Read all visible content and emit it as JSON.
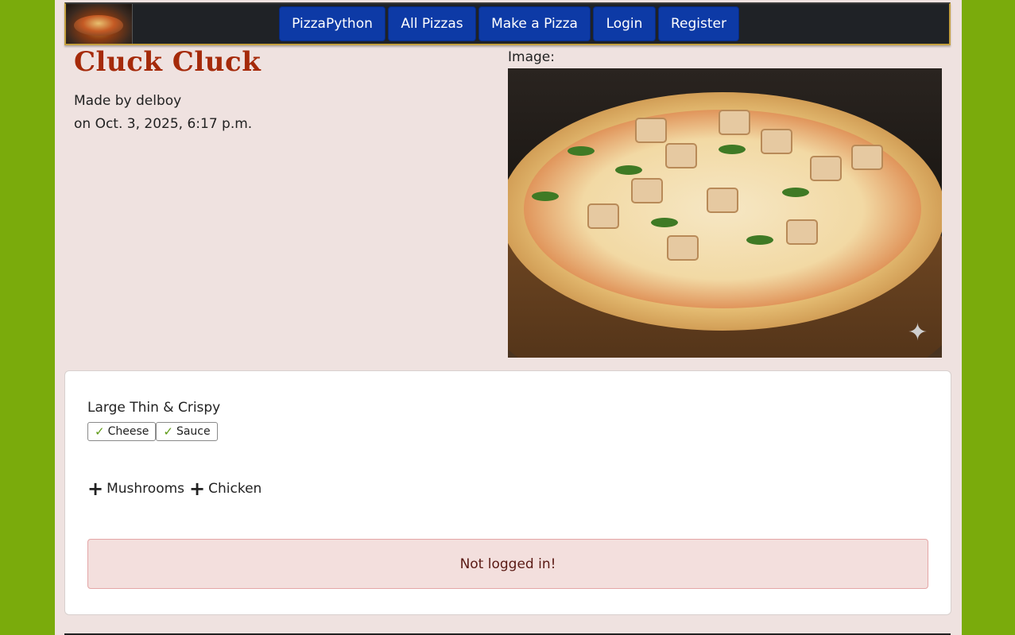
{
  "nav": {
    "items": [
      {
        "label": "PizzaPython"
      },
      {
        "label": "All Pizzas"
      },
      {
        "label": "Make a Pizza"
      },
      {
        "label": "Login"
      },
      {
        "label": "Register"
      }
    ]
  },
  "pizza": {
    "title": "Cluck Cluck",
    "made_by": "Made by delboy",
    "date": "on Oct. 3, 2025, 6:17 p.m.",
    "image_label": "Image:",
    "size": "Large Thin & Crispy",
    "base_items": [
      "Cheese",
      "Sauce"
    ],
    "toppings": [
      "Mushrooms",
      "Chicken"
    ]
  },
  "alert": {
    "message": "Not logged in!"
  },
  "colors": {
    "background": "#7aab0c",
    "page": "#efe2e0",
    "navbar": "#1f2226",
    "nav_button": "#0d3aa6",
    "title": "#a52a0a",
    "check": "#5e9a16"
  },
  "icons": {
    "check": "check-icon",
    "plus": "plus-icon",
    "sparkle": "sparkle-icon"
  }
}
